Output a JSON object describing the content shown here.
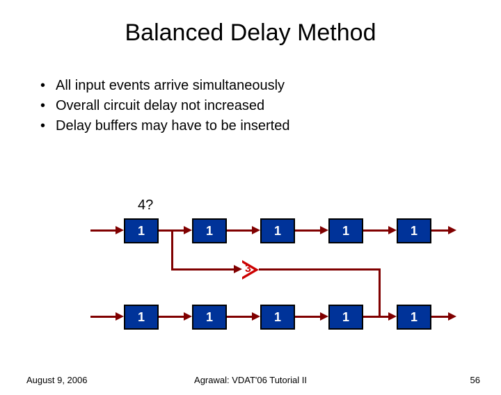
{
  "title": "Balanced Delay Method",
  "bullets": [
    "All input events arrive simultaneously",
    "Overall circuit delay not increased",
    "Delay buffers may have to be inserted"
  ],
  "diagram": {
    "question_label": "4?",
    "top_row": [
      "1",
      "1",
      "1",
      "1",
      "1"
    ],
    "bottom_row": [
      "1",
      "1",
      "1",
      "1",
      "1"
    ],
    "buffer_label": "3"
  },
  "footer": {
    "date": "August 9, 2006",
    "center": "Agrawal: VDAT'06 Tutorial II",
    "page": "56"
  }
}
